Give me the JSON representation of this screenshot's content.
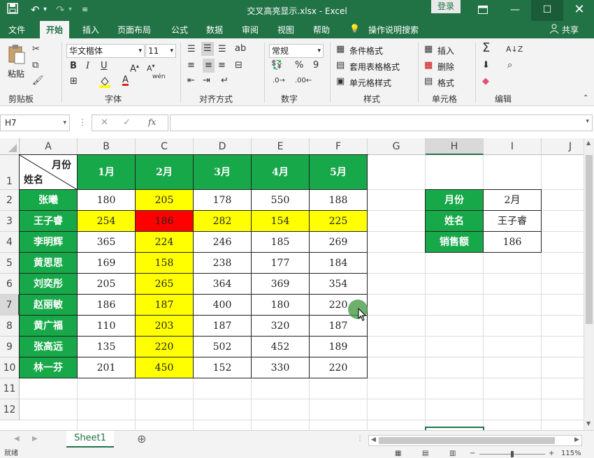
{
  "titlebar": {
    "title": "交叉高亮显示.xlsx  -  Excel",
    "login_label": "登录",
    "save_icon": "save-icon",
    "undo_icon": "undo-icon",
    "redo_icon": "redo-icon"
  },
  "tabs": [
    "文件",
    "开始",
    "插入",
    "页面布局",
    "公式",
    "数据",
    "审阅",
    "视图",
    "帮助",
    "操作说明搜索"
  ],
  "share_label": "共享",
  "ribbon": {
    "clipboard": {
      "paste": "粘贴",
      "label": "剪贴板"
    },
    "font": {
      "name": "华文楷体",
      "size": "11",
      "label": "字体",
      "bold": "B",
      "italic": "I",
      "underline": "U",
      "wen": "wén"
    },
    "alignment": {
      "label": "对齐方式"
    },
    "number": {
      "format": "常规",
      "label": "数字",
      "percent": "%",
      "comma": "9"
    },
    "styles": {
      "conditional": "条件格式",
      "table": "套用表格格式",
      "cell": "单元格样式",
      "label": "样式"
    },
    "cells": {
      "insert": "插入",
      "delete": "删除",
      "format": "格式",
      "label": "单元格"
    },
    "editing": {
      "label": "编辑"
    }
  },
  "formula": {
    "namebox": "H7",
    "fx": "fx",
    "value": ""
  },
  "columns": [
    "A",
    "B",
    "C",
    "D",
    "E",
    "F",
    "G",
    "H",
    "I",
    "J"
  ],
  "rows": [
    "1",
    "2",
    "3",
    "4",
    "5",
    "6",
    "7",
    "8",
    "9",
    "10",
    "11",
    "12"
  ],
  "table": {
    "corner_top": "月份",
    "corner_bottom": "姓名",
    "months": [
      "1月",
      "2月",
      "3月",
      "4月",
      "5月"
    ],
    "names": [
      "张曦",
      "王子睿",
      "李明辉",
      "黄思思",
      "刘奕彤",
      "赵丽敏",
      "黄广福",
      "张高远",
      "林一芬"
    ],
    "data": [
      [
        "180",
        "205",
        "178",
        "550",
        "188"
      ],
      [
        "254",
        "186",
        "282",
        "154",
        "225"
      ],
      [
        "365",
        "224",
        "246",
        "185",
        "269"
      ],
      [
        "169",
        "158",
        "238",
        "177",
        "184"
      ],
      [
        "205",
        "265",
        "364",
        "369",
        "354"
      ],
      [
        "186",
        "187",
        "400",
        "180",
        "220"
      ],
      [
        "110",
        "203",
        "187",
        "320",
        "187"
      ],
      [
        "135",
        "220",
        "502",
        "452",
        "189"
      ],
      [
        "201",
        "450",
        "152",
        "330",
        "220"
      ]
    ]
  },
  "lookup": {
    "labels": [
      "月份",
      "姓名",
      "销售额"
    ],
    "values": [
      "2月",
      "王子睿",
      "186"
    ]
  },
  "sheet_tab": "Sheet1",
  "status": {
    "left": "就绪",
    "zoom": "115%"
  },
  "colors": {
    "accent": "#217346",
    "header_green": "#17a84a",
    "highlight": "#ffff00",
    "intersect": "#ff0000"
  }
}
